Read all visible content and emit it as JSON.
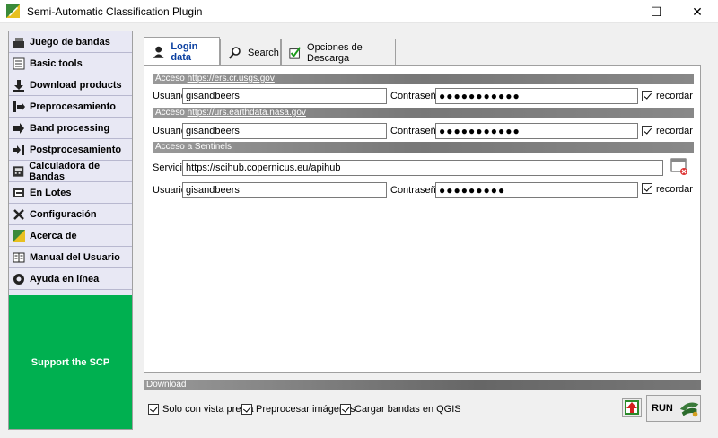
{
  "window": {
    "title": "Semi-Automatic Classification Plugin",
    "min_glyph": "—",
    "max_glyph": "☐",
    "close_glyph": "✕"
  },
  "sidebar": {
    "items": [
      {
        "label": "Juego de bandas",
        "icon": "bandset-icon"
      },
      {
        "label": "Basic tools",
        "icon": "basic-tools-icon"
      },
      {
        "label": "Download products",
        "icon": "download-icon"
      },
      {
        "label": "Preprocesamiento",
        "icon": "preprocessing-icon"
      },
      {
        "label": "Band processing",
        "icon": "band-processing-icon"
      },
      {
        "label": "Postprocesamiento",
        "icon": "postprocessing-icon"
      },
      {
        "label": "Calculadora de Bandas",
        "icon": "calculator-icon"
      },
      {
        "label": "En Lotes",
        "icon": "batch-icon"
      },
      {
        "label": "Configuración",
        "icon": "settings-icon"
      },
      {
        "label": "Acerca de",
        "icon": "about-icon"
      },
      {
        "label": "Manual del Usuario",
        "icon": "manual-icon"
      },
      {
        "label": "Ayuda en línea",
        "icon": "help-icon"
      }
    ],
    "support": "Support the SCP",
    "support_color": "#00b050"
  },
  "tabs": [
    {
      "label": "Login data",
      "icon": "user-icon",
      "active": true
    },
    {
      "label": "Search",
      "icon": "search-icon",
      "active": false
    },
    {
      "label": "Opciones de Descarga",
      "icon": "checkmark-icon",
      "active": false
    }
  ],
  "usgs": {
    "heading": "Acceso ",
    "heading_link": "https://ers.cr.usgs.gov",
    "user_label": "Usuario",
    "user_value": "gisandbeers",
    "pass_label": "Contraseña",
    "pass_value": "●●●●●●●●●●●",
    "remember_label": "recordar"
  },
  "earthdata": {
    "heading": "Acceso ",
    "heading_link": "https://urs.earthdata.nasa.gov",
    "user_label": "Usuario",
    "user_value": "gisandbeers",
    "pass_label": "Contraseña",
    "pass_value": "●●●●●●●●●●●",
    "remember_label": "recordar"
  },
  "sentinels": {
    "heading": "Acceso a Sentinels",
    "service_label": "Servicio",
    "service_value": "https://scihub.copernicus.eu/apihub",
    "user_label": "Usuario",
    "user_value": "gisandbeers",
    "pass_label": "Contraseña",
    "pass_value": "●●●●●●●●●",
    "remember_label": "recordar"
  },
  "download": {
    "heading": "Download",
    "options": [
      "Solo con vista previa",
      "Preprocesar imágenes",
      "Cargar bandas en QGIS"
    ],
    "run_label": "RUN"
  }
}
